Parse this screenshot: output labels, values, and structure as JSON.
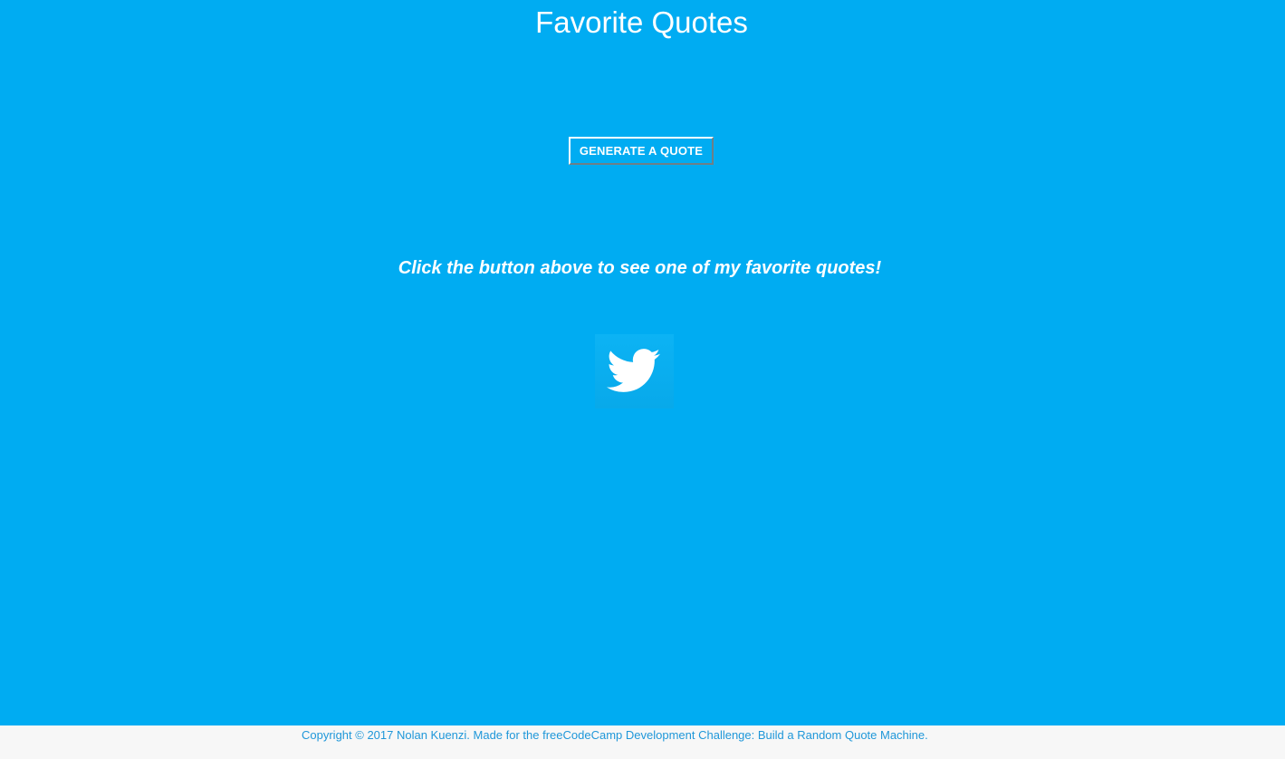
{
  "header": {
    "title": "Favorite Quotes"
  },
  "main": {
    "generate_button_label": "GENERATE A QUOTE",
    "quote_text": "Click the button above to see one of my favorite quotes!",
    "tweet_button_icon": "twitter-bird-icon"
  },
  "footer": {
    "copyright": "Copyright © 2017 Nolan Kuenzi. Made for the freeCodeCamp Development Challenge: Build a Random Quote Machine."
  },
  "colors": {
    "background": "#00acf2",
    "text": "#ffffff",
    "footer_background": "#f7f7f7",
    "footer_text": "#1f97d9"
  }
}
